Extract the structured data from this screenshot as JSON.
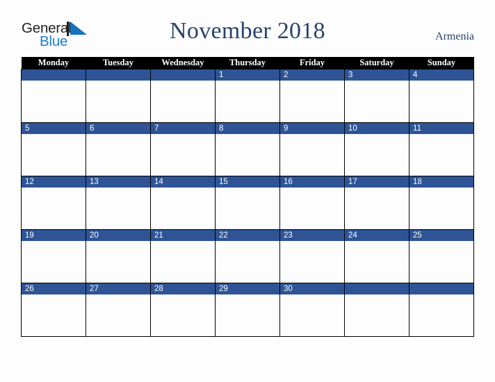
{
  "brand": {
    "name_part1": "General",
    "name_part2": "Blue",
    "mark": "triangle-logo-icon"
  },
  "header": {
    "title": "November 2018",
    "country": "Armenia"
  },
  "colors": {
    "date_bar": "#2e5496",
    "header_row": "#000000",
    "title_text": "#2b436b",
    "brand_blue": "#1d7dd0",
    "cell_background": "#fdfdfd",
    "grid_line": "#000000"
  },
  "calendar": {
    "month": "November",
    "year": "2018",
    "weekday_headers": [
      "Monday",
      "Tuesday",
      "Wednesday",
      "Thursday",
      "Friday",
      "Saturday",
      "Sunday"
    ],
    "weeks": [
      {
        "days": [
          "",
          "",
          "",
          "1",
          "2",
          "3",
          "4"
        ]
      },
      {
        "days": [
          "5",
          "6",
          "7",
          "8",
          "9",
          "10",
          "11"
        ]
      },
      {
        "days": [
          "12",
          "13",
          "14",
          "15",
          "16",
          "17",
          "18"
        ]
      },
      {
        "days": [
          "19",
          "20",
          "21",
          "22",
          "23",
          "24",
          "25"
        ]
      },
      {
        "days": [
          "26",
          "27",
          "28",
          "29",
          "30",
          "",
          ""
        ]
      }
    ]
  }
}
